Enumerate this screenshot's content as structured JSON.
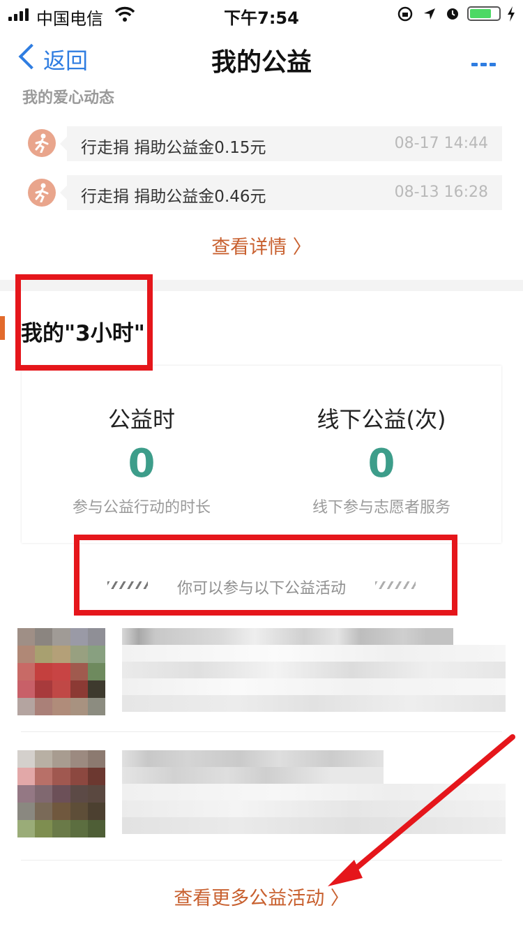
{
  "status_bar": {
    "carrier": "中国电信",
    "time": "下午7:54"
  },
  "nav": {
    "back_label": "返回",
    "title": "我的公益"
  },
  "donation_feed": {
    "heading": "我的爱心动态",
    "items": [
      {
        "text": "行走捐  捐助公益金0.15元",
        "time": "08-17 14:44",
        "icon": "running-person-icon"
      },
      {
        "text": "行走捐  捐助公益金0.46元",
        "time": "08-13 16:28",
        "icon": "running-person-icon"
      }
    ],
    "detail_link": "查看详情 〉"
  },
  "three_hours": {
    "title": "我的\"3小时\"",
    "stats": [
      {
        "label": "公益时",
        "value": "0",
        "desc": "参与公益行动的时长"
      },
      {
        "label": "线下公益(次)",
        "value": "0",
        "desc": "线下参与志愿者服务"
      }
    ],
    "hint": "你可以参与以下公益活动",
    "more_link": "查看更多公益活动 〉"
  },
  "colors": {
    "accent_blue": "#2f7de1",
    "accent_orange": "#c8602f",
    "stat_green": "#3d9d8a",
    "annotation_red": "#e5161b"
  }
}
